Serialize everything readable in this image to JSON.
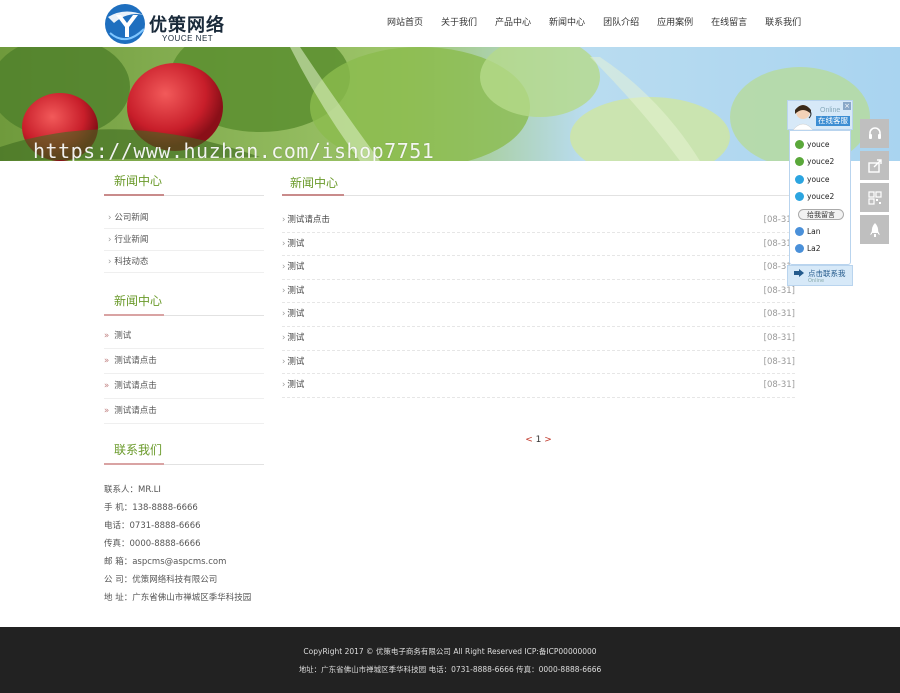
{
  "header": {
    "logo_cn": "优策网络",
    "logo_en": "YOUCE NET",
    "nav": [
      "网站首页",
      "关于我们",
      "产品中心",
      "新闻中心",
      "团队介绍",
      "应用案例",
      "在线留言",
      "联系我们"
    ]
  },
  "banner": {
    "watermark": "https://www.huzhan.com/ishop7751"
  },
  "sidebar": {
    "category_title": "新闻中心",
    "categories": [
      "公司新闻",
      "行业新闻",
      "科技动态"
    ],
    "category_marker": "›",
    "news_title": "新闻中心",
    "news": [
      "测试",
      "测试请点击",
      "测试请点击",
      "测试请点击"
    ],
    "news_marker": "»",
    "contact_title": "联系我们",
    "contact": [
      "联系人：MR.LI",
      "手  机：138-8888-6666",
      "电话：0731-8888-6666",
      "传真：0000-8888-6666",
      "邮  箱：aspcms@aspcms.com",
      "公  司：优策网络科技有限公司",
      "地  址：广东省佛山市禅城区季华科技园"
    ]
  },
  "main": {
    "title": "新闻中心",
    "marker": "›",
    "items": [
      {
        "title": "测试请点击",
        "date": "[08-31]"
      },
      {
        "title": "测试",
        "date": "[08-31]"
      },
      {
        "title": "测试",
        "date": "[08-31]"
      },
      {
        "title": "测试",
        "date": "[08-31]"
      },
      {
        "title": "测试",
        "date": "[08-31]"
      },
      {
        "title": "测试",
        "date": "[08-31]"
      },
      {
        "title": "测试",
        "date": "[08-31]"
      },
      {
        "title": "测试",
        "date": "[08-31]"
      }
    ],
    "pager": {
      "prev": "<",
      "current": "1",
      "next": ">"
    }
  },
  "service": {
    "online_label": "Online",
    "title": "在线客服",
    "close": "×",
    "contacts": [
      {
        "name": "youce",
        "icon": "wangwang-icon"
      },
      {
        "name": "youce2",
        "icon": "wangwang-icon"
      },
      {
        "name": "youce",
        "icon": "skype-icon"
      },
      {
        "name": "youce2",
        "icon": "skype-icon"
      },
      {
        "name": "Lan",
        "icon": "qq-icon"
      },
      {
        "name": "La2",
        "icon": "qq-icon"
      }
    ],
    "message_button": "给我留言",
    "footer_label": "点击联系我",
    "footer_sub": "Online"
  },
  "footer": {
    "line1": "CopyRight 2017 © 优策电子商务有限公司 All Right Reserved ICP:备ICP00000000",
    "line2": "地址：广东省佛山市禅城区季华科技园  电话：0731-8888-6666  传真：0000-8888-6666"
  },
  "colors": {
    "accent_green": "#6a9a2a",
    "accent_red": "#c98b8b",
    "footer_bg": "#222222",
    "service_blue": "#3d8ed3"
  }
}
